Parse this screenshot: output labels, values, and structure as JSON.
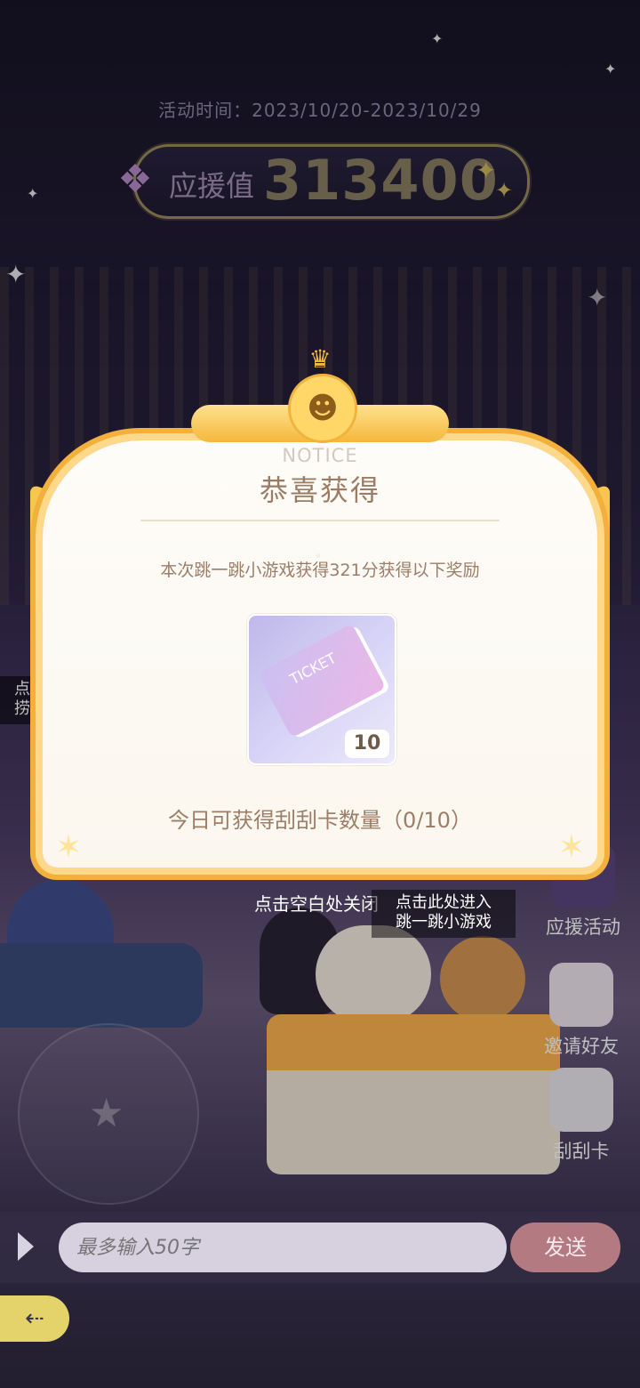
{
  "event": {
    "time_label": "活动时间：2023/10/20-2023/10/29",
    "support_label": "应援值",
    "support_value": "313400"
  },
  "popup": {
    "notice_en": "NOTICE",
    "title": "恭喜获得",
    "description": "本次跳一跳小游戏获得321分获得以下奖励",
    "reward": {
      "icon": "ticket-icon",
      "ticket_text": "TICKET",
      "count": "10"
    },
    "daily_limit": "今日可获得刮刮卡数量（0/10）"
  },
  "hints": {
    "close_hint": "点击空白处关闭",
    "minigame_hint_line1": "点击此处进入",
    "minigame_hint_line2": "跳一跳小游戏",
    "left_hint_line1": "点击",
    "left_hint_line2": "捞球"
  },
  "side_buttons": {
    "support_activity": "应援活动",
    "invite_friends": "邀请好友",
    "scratch_card": "刮刮卡"
  },
  "chat": {
    "placeholder": "最多输入50字",
    "send_label": "发送"
  },
  "colors": {
    "accent_gold": "#f4b03d",
    "popup_bg": "#fefcf8",
    "send_button": "#b47a81"
  }
}
